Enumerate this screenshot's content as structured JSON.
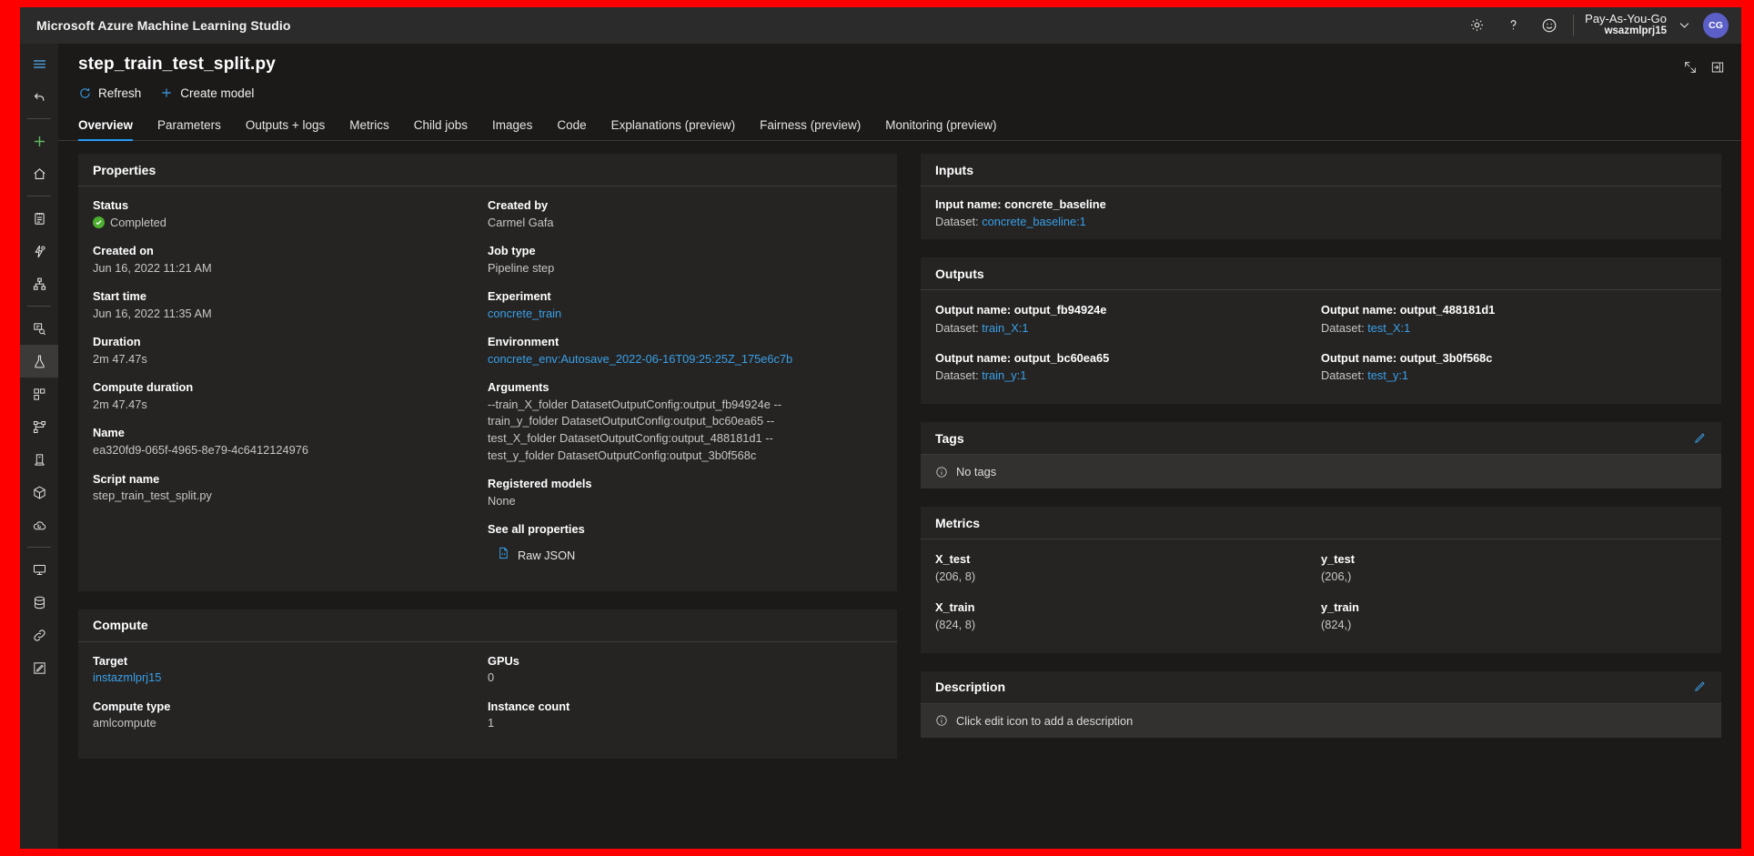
{
  "topbar": {
    "brand": "Microsoft Azure Machine Learning Studio",
    "settings_icon": "gear-icon",
    "help_icon": "question-mark-icon",
    "feedback_icon": "smiley-face-icon",
    "account": {
      "plan": "Pay-As-You-Go",
      "workspace": "wsazmlprj15"
    },
    "avatar_initials": "CG"
  },
  "rail": {
    "items": [
      {
        "name": "hamburger-menu",
        "icon": "hamburger-icon"
      },
      {
        "name": "back-arrow",
        "icon": "undo-arrow-icon"
      },
      {
        "name": "new-item",
        "icon": "plus-icon"
      },
      {
        "name": "home",
        "icon": "home-icon"
      },
      {
        "name": "notebooks",
        "icon": "notebook-icon"
      },
      {
        "name": "automated-ml",
        "icon": "automl-icon"
      },
      {
        "name": "designer",
        "icon": "designer-icon"
      },
      {
        "name": "data-labeling",
        "icon": "labeling-icon"
      },
      {
        "name": "jobs",
        "icon": "flask-icon"
      },
      {
        "name": "components",
        "icon": "components-icon"
      },
      {
        "name": "pipelines",
        "icon": "pipeline-icon"
      },
      {
        "name": "environments",
        "icon": "environment-icon"
      },
      {
        "name": "models",
        "icon": "cube-icon"
      },
      {
        "name": "endpoints",
        "icon": "cloud-endpoint-icon"
      },
      {
        "name": "compute",
        "icon": "monitor-icon"
      },
      {
        "name": "datastores",
        "icon": "database-icon"
      },
      {
        "name": "linked-services",
        "icon": "link-icon"
      },
      {
        "name": "data-labeling-projects",
        "icon": "pencil-square-icon"
      }
    ],
    "active_index": 8
  },
  "page": {
    "title": "step_train_test_split.py",
    "commands": [
      {
        "label": "Refresh",
        "icon": "refresh-icon"
      },
      {
        "label": "Create model",
        "icon": "plus-icon"
      }
    ],
    "window_buttons": [
      {
        "name": "collapse-icon"
      },
      {
        "name": "expand-panel-icon"
      }
    ],
    "tabs": [
      {
        "label": "Overview",
        "active": true
      },
      {
        "label": "Parameters",
        "active": false
      },
      {
        "label": "Outputs + logs",
        "active": false
      },
      {
        "label": "Metrics",
        "active": false
      },
      {
        "label": "Child jobs",
        "active": false
      },
      {
        "label": "Images",
        "active": false
      },
      {
        "label": "Code",
        "active": false
      },
      {
        "label": "Explanations (preview)",
        "active": false
      },
      {
        "label": "Fairness (preview)",
        "active": false
      },
      {
        "label": "Monitoring (preview)",
        "active": false
      }
    ]
  },
  "properties": {
    "title": "Properties",
    "left": [
      {
        "key": "Status",
        "value": "Completed",
        "status": true
      },
      {
        "key": "Created on",
        "value": "Jun 16, 2022 11:21 AM"
      },
      {
        "key": "Start time",
        "value": "Jun 16, 2022 11:35 AM"
      },
      {
        "key": "Duration",
        "value": "2m 47.47s"
      },
      {
        "key": "Compute duration",
        "value": "2m 47.47s"
      },
      {
        "key": "Name",
        "value": "ea320fd9-065f-4965-8e79-4c6412124976"
      },
      {
        "key": "Script name",
        "value": "step_train_test_split.py"
      }
    ],
    "right": [
      {
        "key": "Created by",
        "value": "Carmel Gafa"
      },
      {
        "key": "Job type",
        "value": "Pipeline step"
      },
      {
        "key": "Experiment",
        "value": "concrete_train",
        "link": true
      },
      {
        "key": "Environment",
        "value": "concrete_env:Autosave_2022-06-16T09:25:25Z_175e6c7b",
        "link": true
      },
      {
        "key": "Arguments",
        "value": "--train_X_folder DatasetOutputConfig:output_fb94924e --train_y_folder DatasetOutputConfig:output_bc60ea65 --test_X_folder DatasetOutputConfig:output_488181d1 --test_y_folder DatasetOutputConfig:output_3b0f568c"
      },
      {
        "key": "Registered models",
        "value": "None"
      },
      {
        "key": "See all properties",
        "value": ""
      }
    ],
    "raw_json_label": "Raw JSON",
    "raw_json_icon": "json-file-icon"
  },
  "compute": {
    "title": "Compute",
    "left": [
      {
        "key": "Target",
        "value": "instazmlprj15",
        "link": true
      },
      {
        "key": "Compute type",
        "value": "amlcompute"
      }
    ],
    "right": [
      {
        "key": "GPUs",
        "value": "0"
      },
      {
        "key": "Instance count",
        "value": "1"
      }
    ]
  },
  "inputs": {
    "title": "Inputs",
    "items": [
      {
        "name_label": "Input name: concrete_baseline",
        "dataset_label": "Dataset:",
        "dataset_link": "concrete_baseline:1"
      }
    ]
  },
  "outputs": {
    "title": "Outputs",
    "items": [
      {
        "name_label": "Output name: output_fb94924e",
        "dataset_label": "Dataset:",
        "dataset_link": "train_X:1"
      },
      {
        "name_label": "Output name: output_488181d1",
        "dataset_label": "Dataset:",
        "dataset_link": "test_X:1"
      },
      {
        "name_label": "Output name: output_bc60ea65",
        "dataset_label": "Dataset:",
        "dataset_link": "train_y:1"
      },
      {
        "name_label": "Output name: output_3b0f568c",
        "dataset_label": "Dataset:",
        "dataset_link": "test_y:1"
      }
    ]
  },
  "tags": {
    "title": "Tags",
    "edit_icon": "pencil-icon",
    "empty_text": "No tags",
    "info_icon": "info-circle-icon"
  },
  "metrics": {
    "title": "Metrics",
    "items": [
      {
        "key": "X_test",
        "value": "(206, 8)"
      },
      {
        "key": "y_test",
        "value": "(206,)"
      },
      {
        "key": "X_train",
        "value": "(824, 8)"
      },
      {
        "key": "y_train",
        "value": "(824,)"
      }
    ]
  },
  "description": {
    "title": "Description",
    "edit_icon": "pencil-icon",
    "empty_text": "Click edit icon to add a description",
    "info_icon": "info-circle-icon"
  },
  "colors": {
    "accent": "#3aa0e8",
    "success": "#4caf2f",
    "page_bg": "#1b1a19",
    "card_bg": "#252423",
    "border": "#ff0000"
  }
}
